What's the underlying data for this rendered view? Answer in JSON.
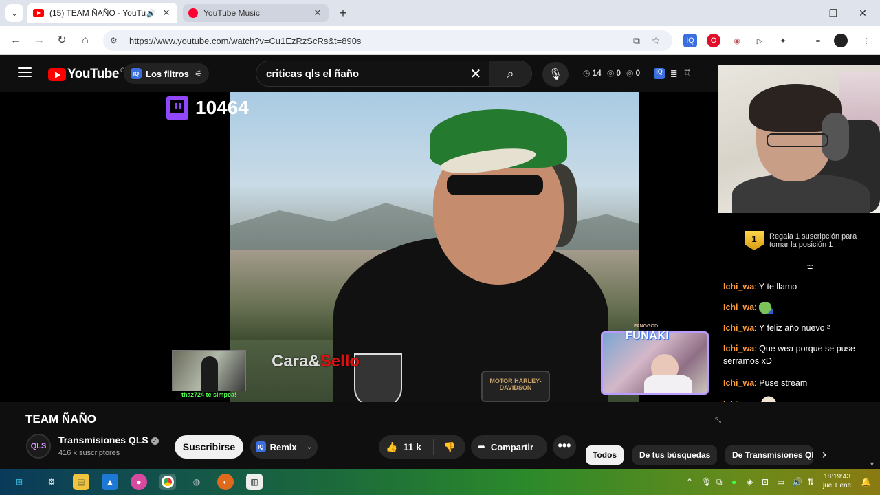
{
  "browser": {
    "tabs": [
      {
        "title": "(15) TEAM ÑAÑO - YouTub",
        "active": true,
        "audio_icon": "speaker-icon"
      },
      {
        "title": "YouTube Music",
        "active": false
      }
    ],
    "url": "https://www.youtube.com/watch?v=Cu1EzRzScRs&t=890s"
  },
  "youtube": {
    "logo_text": "YouTube",
    "region": "CL",
    "filters_label": "Los filtros",
    "iq_label": "IQ",
    "search_query": "criticas qls el ñaño",
    "header_stats": [
      {
        "icon": "clock-icon",
        "value": "14"
      },
      {
        "icon": "eye-icon",
        "value": "0"
      },
      {
        "icon": "eye-icon",
        "value": "0"
      }
    ]
  },
  "player": {
    "twitch_viewers": "10464",
    "caption_left": "Cara&",
    "caption_right": "Sello",
    "bike_logo": "MOTOR HARLEY-DAVIDSON",
    "sub_alert": "thaz724 te simpea!",
    "funaki_label": "FUNAKI",
    "funaki_tag": "FANGGOD"
  },
  "chat": {
    "gift_rank": "1",
    "gift_text": "Regala 1 suscripción para tomar la posición 1",
    "messages": [
      {
        "user": "Ichi_wa",
        "text": "Y te llamo",
        "emote": ""
      },
      {
        "user": "Ichi_wa",
        "text": "",
        "emote": "pepe"
      },
      {
        "user": "Ichi_wa",
        "text": "Y feliz año nuevo ²",
        "emote": ""
      },
      {
        "user": "Ichi_wa",
        "text": "Que wea porque se puse serramos xD",
        "emote": ""
      },
      {
        "user": "Ichi_wa",
        "text": "Puse stream",
        "emote": ""
      },
      {
        "user": "Ichi_wa",
        "text": "",
        "emote": "cat"
      }
    ]
  },
  "video": {
    "title": "TEAM ÑAÑO",
    "channel_name": "Transmisiones QLS",
    "channel_avatar": "QLS",
    "subscribers": "416 k suscriptores",
    "subscribe_label": "Suscribirse",
    "remix_label": "Remix",
    "likes": "11 k",
    "share_label": "Compartir",
    "more_label": "•••",
    "chips": [
      "Todos",
      "De tus búsquedas",
      "De Transmisiones QLS"
    ]
  },
  "taskbar": {
    "time": "18:19:43",
    "date": "jue 1 ene"
  }
}
